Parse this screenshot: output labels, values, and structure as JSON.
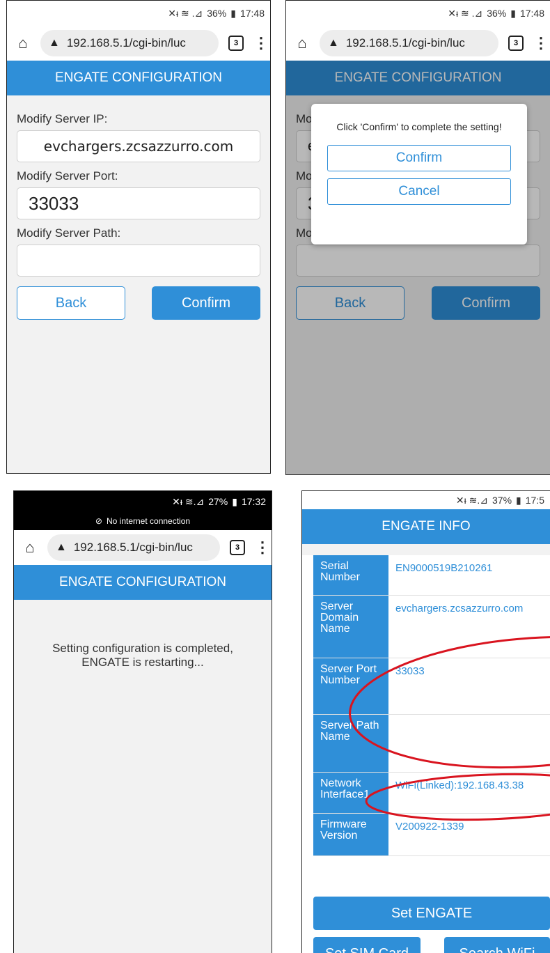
{
  "status": {
    "top": {
      "battery": "36%",
      "time": "17:48"
    },
    "bottom_left": {
      "battery": "27%",
      "time": "17:32",
      "notice": "No internet connection"
    },
    "bottom_right": {
      "battery": "37%",
      "time": "17:5"
    }
  },
  "browser": {
    "url": "192.168.5.1/cgi-bin/luc",
    "tab_count": "3"
  },
  "config": {
    "title": "ENGATE CONFIGURATION",
    "ip_label": "Modify Server IP:",
    "ip_value": "evchargers.zcsazzurro.com",
    "port_label": "Modify Server Port:",
    "port_value": "33033",
    "path_label": "Modify Server Path:",
    "path_value": "",
    "back_label": "Back",
    "confirm_label": "Confirm"
  },
  "dialog": {
    "message": "Click 'Confirm' to complete the setting!",
    "confirm_label": "Confirm",
    "cancel_label": "Cancel"
  },
  "completed": {
    "line1": "Setting configuration is completed,",
    "line2": "ENGATE is restarting..."
  },
  "info": {
    "title": "ENGATE INFO",
    "rows": [
      {
        "key": "Serial Number",
        "value": "EN9000519B210261"
      },
      {
        "key": "Server Domain Name",
        "value": "evchargers.zcsazzurro.com"
      },
      {
        "key": "Server Port Number",
        "value": "33033"
      },
      {
        "key": "Server Path Name",
        "value": ""
      },
      {
        "key": "Network Interface1",
        "value": "WiFi(Linked):192.168.43.38"
      },
      {
        "key": "Firmware Version",
        "value": "V200922-1339"
      }
    ],
    "set_engate_label": "Set ENGATE",
    "set_sim_label": "Set SIM Card",
    "search_wifi_label": "Search WiFi"
  },
  "colors": {
    "accent": "#2f8fd8",
    "annotation": "#d9141f"
  }
}
